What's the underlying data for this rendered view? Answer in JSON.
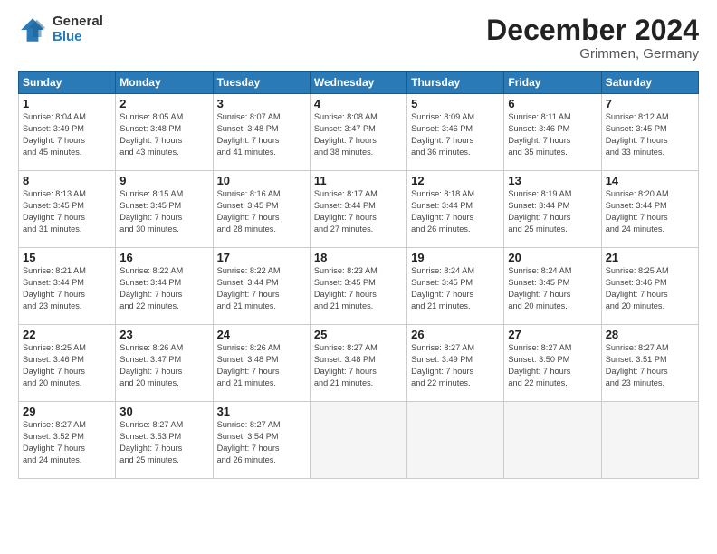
{
  "logo": {
    "general": "General",
    "blue": "Blue"
  },
  "title": "December 2024",
  "subtitle": "Grimmen, Germany",
  "headers": [
    "Sunday",
    "Monday",
    "Tuesday",
    "Wednesday",
    "Thursday",
    "Friday",
    "Saturday"
  ],
  "weeks": [
    [
      {
        "day": "1",
        "sunrise": "8:04 AM",
        "sunset": "3:49 PM",
        "daylight": "7 hours and 45 minutes."
      },
      {
        "day": "2",
        "sunrise": "8:05 AM",
        "sunset": "3:48 PM",
        "daylight": "7 hours and 43 minutes."
      },
      {
        "day": "3",
        "sunrise": "8:07 AM",
        "sunset": "3:48 PM",
        "daylight": "7 hours and 41 minutes."
      },
      {
        "day": "4",
        "sunrise": "8:08 AM",
        "sunset": "3:47 PM",
        "daylight": "7 hours and 38 minutes."
      },
      {
        "day": "5",
        "sunrise": "8:09 AM",
        "sunset": "3:46 PM",
        "daylight": "7 hours and 36 minutes."
      },
      {
        "day": "6",
        "sunrise": "8:11 AM",
        "sunset": "3:46 PM",
        "daylight": "7 hours and 35 minutes."
      },
      {
        "day": "7",
        "sunrise": "8:12 AM",
        "sunset": "3:45 PM",
        "daylight": "7 hours and 33 minutes."
      }
    ],
    [
      {
        "day": "8",
        "sunrise": "8:13 AM",
        "sunset": "3:45 PM",
        "daylight": "7 hours and 31 minutes."
      },
      {
        "day": "9",
        "sunrise": "8:15 AM",
        "sunset": "3:45 PM",
        "daylight": "7 hours and 30 minutes."
      },
      {
        "day": "10",
        "sunrise": "8:16 AM",
        "sunset": "3:45 PM",
        "daylight": "7 hours and 28 minutes."
      },
      {
        "day": "11",
        "sunrise": "8:17 AM",
        "sunset": "3:44 PM",
        "daylight": "7 hours and 27 minutes."
      },
      {
        "day": "12",
        "sunrise": "8:18 AM",
        "sunset": "3:44 PM",
        "daylight": "7 hours and 26 minutes."
      },
      {
        "day": "13",
        "sunrise": "8:19 AM",
        "sunset": "3:44 PM",
        "daylight": "7 hours and 25 minutes."
      },
      {
        "day": "14",
        "sunrise": "8:20 AM",
        "sunset": "3:44 PM",
        "daylight": "7 hours and 24 minutes."
      }
    ],
    [
      {
        "day": "15",
        "sunrise": "8:21 AM",
        "sunset": "3:44 PM",
        "daylight": "7 hours and 23 minutes."
      },
      {
        "day": "16",
        "sunrise": "8:22 AM",
        "sunset": "3:44 PM",
        "daylight": "7 hours and 22 minutes."
      },
      {
        "day": "17",
        "sunrise": "8:22 AM",
        "sunset": "3:44 PM",
        "daylight": "7 hours and 21 minutes."
      },
      {
        "day": "18",
        "sunrise": "8:23 AM",
        "sunset": "3:45 PM",
        "daylight": "7 hours and 21 minutes."
      },
      {
        "day": "19",
        "sunrise": "8:24 AM",
        "sunset": "3:45 PM",
        "daylight": "7 hours and 21 minutes."
      },
      {
        "day": "20",
        "sunrise": "8:24 AM",
        "sunset": "3:45 PM",
        "daylight": "7 hours and 20 minutes."
      },
      {
        "day": "21",
        "sunrise": "8:25 AM",
        "sunset": "3:46 PM",
        "daylight": "7 hours and 20 minutes."
      }
    ],
    [
      {
        "day": "22",
        "sunrise": "8:25 AM",
        "sunset": "3:46 PM",
        "daylight": "7 hours and 20 minutes."
      },
      {
        "day": "23",
        "sunrise": "8:26 AM",
        "sunset": "3:47 PM",
        "daylight": "7 hours and 20 minutes."
      },
      {
        "day": "24",
        "sunrise": "8:26 AM",
        "sunset": "3:48 PM",
        "daylight": "7 hours and 21 minutes."
      },
      {
        "day": "25",
        "sunrise": "8:27 AM",
        "sunset": "3:48 PM",
        "daylight": "7 hours and 21 minutes."
      },
      {
        "day": "26",
        "sunrise": "8:27 AM",
        "sunset": "3:49 PM",
        "daylight": "7 hours and 22 minutes."
      },
      {
        "day": "27",
        "sunrise": "8:27 AM",
        "sunset": "3:50 PM",
        "daylight": "7 hours and 22 minutes."
      },
      {
        "day": "28",
        "sunrise": "8:27 AM",
        "sunset": "3:51 PM",
        "daylight": "7 hours and 23 minutes."
      }
    ],
    [
      {
        "day": "29",
        "sunrise": "8:27 AM",
        "sunset": "3:52 PM",
        "daylight": "7 hours and 24 minutes."
      },
      {
        "day": "30",
        "sunrise": "8:27 AM",
        "sunset": "3:53 PM",
        "daylight": "7 hours and 25 minutes."
      },
      {
        "day": "31",
        "sunrise": "8:27 AM",
        "sunset": "3:54 PM",
        "daylight": "7 hours and 26 minutes."
      },
      null,
      null,
      null,
      null
    ]
  ]
}
